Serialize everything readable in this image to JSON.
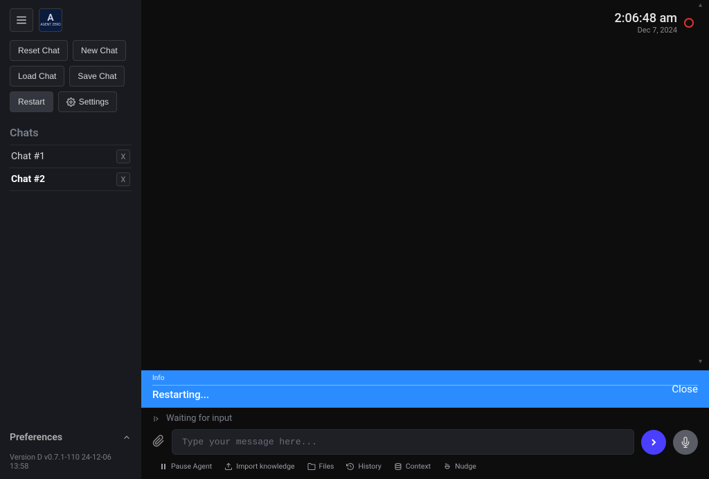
{
  "header": {
    "time": "2:06:48 am",
    "date": "Dec 7, 2024"
  },
  "sidebar": {
    "logo_text": "AGENT ZERO",
    "buttons": {
      "reset": "Reset Chat",
      "new": "New Chat",
      "load": "Load Chat",
      "save": "Save Chat",
      "restart": "Restart",
      "settings": "Settings"
    },
    "chats_header": "Chats",
    "chats": [
      {
        "label": "Chat #1",
        "close": "X",
        "active": false
      },
      {
        "label": "Chat #2",
        "close": "X",
        "active": true
      }
    ],
    "preferences_label": "Preferences",
    "version": "Version D v0.7.1-110 24-12-06 13:58"
  },
  "info_bar": {
    "label": "Info",
    "message": "Restarting...",
    "close": "Close"
  },
  "input": {
    "waiting": "Waiting for input",
    "placeholder": "Type your message here..."
  },
  "toolbar": {
    "pause": "Pause Agent",
    "import": "Import knowledge",
    "files": "Files",
    "history": "History",
    "context": "Context",
    "nudge": "Nudge"
  }
}
